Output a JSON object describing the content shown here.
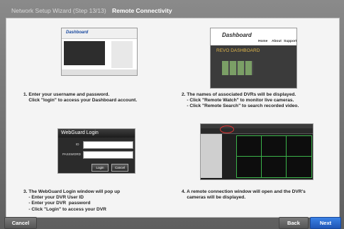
{
  "window": {
    "title_step": "Network Setup Wizard (Step 13/13)",
    "title_page": "Remote Connectivity"
  },
  "steps": [
    {
      "caption": "1. Enter your username and password.\n    Click \"login\" to access your Dashboard account."
    },
    {
      "caption": "2. The names of associated DVRs will be displayed.\n    - Click \"Remote Watch\" to monitor live cameras.\n    - Click \"Remote Search\" to search recorded video."
    },
    {
      "caption": "3. The WebGuard Login window will pop up\n    - Enter your DVR User ID\n    - Enter your DVR  password\n    - Click \"Login\" to access your DVR"
    },
    {
      "caption": "4. A remote connection window will open and the DVR's\n    cameras will be displayed."
    }
  ],
  "thumb1": {
    "logo": "Dashboard"
  },
  "thumb2": {
    "logo": "Dashboard",
    "nav": [
      "Home",
      "About",
      "Support"
    ],
    "heading": "REVO DASHBOARD"
  },
  "thumb3": {
    "title": "WebGuard Login",
    "id_label": "ID",
    "password_label": "PASSWORD",
    "login_btn": "Login",
    "cancel_btn": "Cancel"
  },
  "buttons": {
    "cancel": "Cancel",
    "back": "Back",
    "next": "Next"
  }
}
